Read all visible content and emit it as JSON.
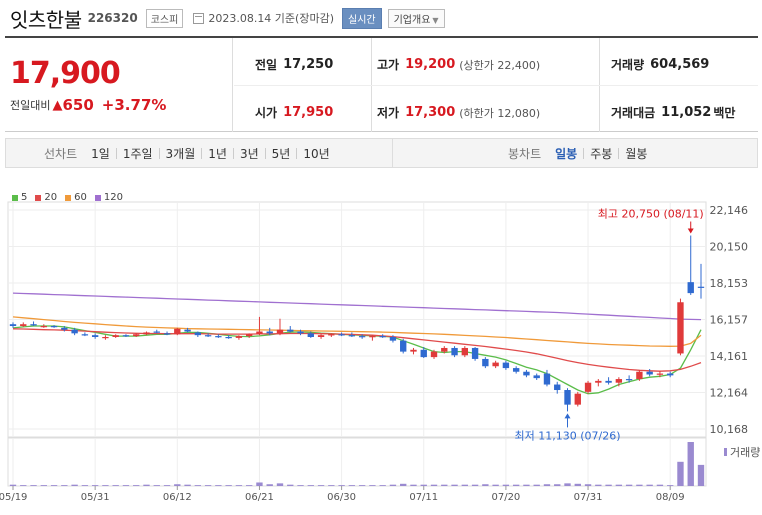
{
  "header": {
    "name": "잇츠한불",
    "code": "226320",
    "market": "코스피",
    "date": "2023.08.14 기준(장마감)",
    "realtime": "실시간",
    "info": "기업개요"
  },
  "summary": {
    "price": "17,900",
    "change_label": "전일대비",
    "change_value": "650",
    "change_pct": "+3.77%",
    "prev_label": "전일",
    "prev_value": "17,250",
    "open_label": "시가",
    "open_value": "17,950",
    "high_label": "고가",
    "high_value": "19,200",
    "high_limit": "(상한가 22,400)",
    "low_label": "저가",
    "low_value": "17,300",
    "low_limit": "(하한가 12,080)",
    "volume_label": "거래량",
    "volume_value": "604,569",
    "amount_label": "거래대금",
    "amount_value": "11,052",
    "amount_unit": "백만"
  },
  "period_bar": {
    "line_title": "선차트",
    "line_items": [
      "1일",
      "1주일",
      "3개월",
      "1년",
      "3년",
      "5년",
      "10년"
    ],
    "candle_title": "봉차트",
    "candle_items": [
      "일봉",
      "주봉",
      "월봉"
    ],
    "candle_selected": "일봉"
  },
  "colors": {
    "up": "#e03a3a",
    "down": "#2f6ad0",
    "ma5": "#5bbd4a",
    "ma20": "#e04b4b",
    "ma60": "#f09a3a",
    "ma120": "#a070d0",
    "volume": "#9a8ad0"
  },
  "chart_data": {
    "type": "candlestick",
    "title": "",
    "xlabel": "",
    "ylabel": "",
    "ylim": [
      10168,
      22146
    ],
    "y_ticks": [
      "22,146",
      "20,150",
      "18,153",
      "16,157",
      "14,161",
      "12,164",
      "10,168"
    ],
    "y_tick_values": [
      22146,
      20150,
      18153,
      16157,
      14161,
      12164,
      10168
    ],
    "x_ticks": [
      "05/19",
      "05/31",
      "06/12",
      "06/21",
      "06/30",
      "07/11",
      "07/20",
      "07/31",
      "08/09"
    ],
    "x_tick_index": [
      0,
      8,
      16,
      24,
      32,
      40,
      48,
      56,
      64
    ],
    "legend": [
      "5",
      "20",
      "60",
      "120"
    ],
    "volume_label": "거래량",
    "annotations": {
      "max": "최고 20,750 (08/11)",
      "min": "최저 11,130 (07/26)"
    },
    "candles": [
      {
        "o": 15900,
        "h": 16000,
        "l": 15700,
        "c": 15800
      },
      {
        "o": 15800,
        "h": 16000,
        "l": 15750,
        "c": 15900
      },
      {
        "o": 15900,
        "h": 16050,
        "l": 15800,
        "c": 15850
      },
      {
        "o": 15800,
        "h": 15900,
        "l": 15700,
        "c": 15800
      },
      {
        "o": 15800,
        "h": 15850,
        "l": 15700,
        "c": 15750
      },
      {
        "o": 15700,
        "h": 15800,
        "l": 15500,
        "c": 15600
      },
      {
        "o": 15600,
        "h": 15700,
        "l": 15300,
        "c": 15400
      },
      {
        "o": 15350,
        "h": 15450,
        "l": 15250,
        "c": 15300
      },
      {
        "o": 15300,
        "h": 15400,
        "l": 15100,
        "c": 15200
      },
      {
        "o": 15150,
        "h": 15300,
        "l": 15050,
        "c": 15200
      },
      {
        "o": 15200,
        "h": 15350,
        "l": 15150,
        "c": 15300
      },
      {
        "o": 15300,
        "h": 15350,
        "l": 15200,
        "c": 15250
      },
      {
        "o": 15250,
        "h": 15400,
        "l": 15200,
        "c": 15350
      },
      {
        "o": 15350,
        "h": 15500,
        "l": 15300,
        "c": 15450
      },
      {
        "o": 15500,
        "h": 15600,
        "l": 15400,
        "c": 15450
      },
      {
        "o": 15400,
        "h": 15500,
        "l": 15300,
        "c": 15350
      },
      {
        "o": 15350,
        "h": 15700,
        "l": 15300,
        "c": 15650
      },
      {
        "o": 15600,
        "h": 15700,
        "l": 15450,
        "c": 15500
      },
      {
        "o": 15450,
        "h": 15500,
        "l": 15200,
        "c": 15300
      },
      {
        "o": 15300,
        "h": 15400,
        "l": 15200,
        "c": 15250
      },
      {
        "o": 15250,
        "h": 15350,
        "l": 15150,
        "c": 15200
      },
      {
        "o": 15200,
        "h": 15300,
        "l": 15100,
        "c": 15150
      },
      {
        "o": 15150,
        "h": 15300,
        "l": 15050,
        "c": 15250
      },
      {
        "o": 15250,
        "h": 15400,
        "l": 15150,
        "c": 15350
      },
      {
        "o": 15350,
        "h": 16300,
        "l": 15300,
        "c": 15500
      },
      {
        "o": 15500,
        "h": 15700,
        "l": 15300,
        "c": 15400
      },
      {
        "o": 15400,
        "h": 16200,
        "l": 15300,
        "c": 15600
      },
      {
        "o": 15600,
        "h": 15800,
        "l": 15450,
        "c": 15500
      },
      {
        "o": 15500,
        "h": 15600,
        "l": 15300,
        "c": 15400
      },
      {
        "o": 15400,
        "h": 15500,
        "l": 15150,
        "c": 15200
      },
      {
        "o": 15200,
        "h": 15350,
        "l": 15100,
        "c": 15300
      },
      {
        "o": 15300,
        "h": 15400,
        "l": 15200,
        "c": 15350
      },
      {
        "o": 15350,
        "h": 15450,
        "l": 15250,
        "c": 15300
      },
      {
        "o": 15300,
        "h": 15450,
        "l": 15200,
        "c": 15250
      },
      {
        "o": 15250,
        "h": 15350,
        "l": 15100,
        "c": 15200
      },
      {
        "o": 15200,
        "h": 15300,
        "l": 15000,
        "c": 15250
      },
      {
        "o": 15250,
        "h": 15350,
        "l": 15150,
        "c": 15200
      },
      {
        "o": 15200,
        "h": 15300,
        "l": 14900,
        "c": 15000
      },
      {
        "o": 15000,
        "h": 15100,
        "l": 14300,
        "c": 14400
      },
      {
        "o": 14400,
        "h": 14600,
        "l": 14250,
        "c": 14500
      },
      {
        "o": 14500,
        "h": 14650,
        "l": 14050,
        "c": 14100
      },
      {
        "o": 14100,
        "h": 14500,
        "l": 14000,
        "c": 14400
      },
      {
        "o": 14400,
        "h": 14700,
        "l": 14300,
        "c": 14600
      },
      {
        "o": 14600,
        "h": 14700,
        "l": 14100,
        "c": 14200
      },
      {
        "o": 14200,
        "h": 14700,
        "l": 14100,
        "c": 14600
      },
      {
        "o": 14600,
        "h": 14650,
        "l": 13900,
        "c": 14000
      },
      {
        "o": 14000,
        "h": 14100,
        "l": 13500,
        "c": 13600
      },
      {
        "o": 13600,
        "h": 13900,
        "l": 13500,
        "c": 13800
      },
      {
        "o": 13800,
        "h": 13900,
        "l": 13400,
        "c": 13500
      },
      {
        "o": 13500,
        "h": 13600,
        "l": 13200,
        "c": 13300
      },
      {
        "o": 13300,
        "h": 13400,
        "l": 13000,
        "c": 13100
      },
      {
        "o": 13100,
        "h": 13200,
        "l": 12850,
        "c": 12950
      },
      {
        "o": 13200,
        "h": 13400,
        "l": 12500,
        "c": 12600
      },
      {
        "o": 12600,
        "h": 12750,
        "l": 12100,
        "c": 12300
      },
      {
        "o": 12300,
        "h": 12400,
        "l": 11130,
        "c": 11500
      },
      {
        "o": 11500,
        "h": 12200,
        "l": 11400,
        "c": 12100
      },
      {
        "o": 12200,
        "h": 12800,
        "l": 12100,
        "c": 12700
      },
      {
        "o": 12700,
        "h": 12900,
        "l": 12500,
        "c": 12800
      },
      {
        "o": 12800,
        "h": 13000,
        "l": 12600,
        "c": 12700
      },
      {
        "o": 12700,
        "h": 13000,
        "l": 12500,
        "c": 12900
      },
      {
        "o": 12900,
        "h": 13100,
        "l": 12700,
        "c": 12850
      },
      {
        "o": 12900,
        "h": 13400,
        "l": 12800,
        "c": 13300
      },
      {
        "o": 13300,
        "h": 13450,
        "l": 13050,
        "c": 13150
      },
      {
        "o": 13150,
        "h": 13350,
        "l": 13000,
        "c": 13200
      },
      {
        "o": 13200,
        "h": 13300,
        "l": 13000,
        "c": 13100
      },
      {
        "o": 14300,
        "h": 17300,
        "l": 14200,
        "c": 17100
      },
      {
        "o": 18200,
        "h": 20750,
        "l": 17500,
        "c": 17600
      },
      {
        "o": 17950,
        "h": 19200,
        "l": 17300,
        "c": 17900
      }
    ],
    "ma": [
      {
        "name": "5",
        "values": [
          15700,
          15750,
          15800,
          15800,
          15800,
          15750,
          15650,
          15550,
          15450,
          15350,
          15250,
          15250,
          15250,
          15300,
          15350,
          15350,
          15400,
          15450,
          15450,
          15400,
          15350,
          15280,
          15230,
          15220,
          15260,
          15320,
          15400,
          15460,
          15480,
          15450,
          15410,
          15380,
          15350,
          15320,
          15290,
          15260,
          15240,
          15200,
          15000,
          14800,
          14600,
          14400,
          14350,
          14400,
          14400,
          14300,
          14200,
          14100,
          13950,
          13750,
          13550,
          13400,
          13200,
          12900,
          12600,
          12300,
          12100,
          12150,
          12350,
          12600,
          12750,
          12900,
          13000,
          13050,
          13150,
          13500,
          14500,
          15600
        ]
      },
      {
        "name": "20",
        "values": [
          15650,
          15640,
          15620,
          15600,
          15590,
          15570,
          15550,
          15520,
          15490,
          15460,
          15440,
          15420,
          15400,
          15390,
          15390,
          15380,
          15380,
          15380,
          15380,
          15370,
          15360,
          15360,
          15360,
          15360,
          15370,
          15370,
          15380,
          15390,
          15390,
          15390,
          15380,
          15370,
          15360,
          15340,
          15320,
          15300,
          15260,
          15220,
          15160,
          15100,
          15040,
          14980,
          14920,
          14860,
          14800,
          14740,
          14680,
          14610,
          14540,
          14460,
          14380,
          14280,
          14160,
          14040,
          13910,
          13800,
          13700,
          13620,
          13550,
          13480,
          13420,
          13380,
          13350,
          13330,
          13350,
          13430,
          13600,
          13800
        ]
      },
      {
        "name": "60",
        "values": [
          16300,
          16250,
          16200,
          16150,
          16100,
          16050,
          16000,
          15960,
          15920,
          15880,
          15840,
          15800,
          15770,
          15740,
          15720,
          15700,
          15680,
          15660,
          15650,
          15640,
          15630,
          15620,
          15610,
          15600,
          15590,
          15580,
          15570,
          15560,
          15550,
          15540,
          15530,
          15520,
          15510,
          15500,
          15490,
          15480,
          15470,
          15450,
          15430,
          15410,
          15390,
          15370,
          15350,
          15320,
          15290,
          15260,
          15230,
          15200,
          15170,
          15130,
          15090,
          15050,
          15010,
          14970,
          14930,
          14890,
          14850,
          14820,
          14790,
          14770,
          14750,
          14730,
          14710,
          14700,
          14690,
          14700,
          14850,
          15300
        ]
      },
      {
        "name": "120",
        "values": [
          17600,
          17580,
          17560,
          17540,
          17520,
          17500,
          17480,
          17460,
          17440,
          17420,
          17400,
          17380,
          17360,
          17340,
          17320,
          17300,
          17280,
          17260,
          17240,
          17220,
          17200,
          17180,
          17160,
          17140,
          17120,
          17100,
          17080,
          17060,
          17040,
          17020,
          17000,
          16980,
          16960,
          16940,
          16920,
          16900,
          16880,
          16860,
          16840,
          16820,
          16800,
          16780,
          16760,
          16740,
          16720,
          16700,
          16680,
          16660,
          16640,
          16620,
          16600,
          16580,
          16560,
          16540,
          16510,
          16480,
          16450,
          16420,
          16390,
          16360,
          16330,
          16300,
          16270,
          16240,
          16210,
          16180,
          16160,
          16150
        ]
      }
    ],
    "volume": [
      3,
      2,
      2,
      2,
      2,
      2,
      3,
      2,
      2,
      2,
      2,
      2,
      2,
      3,
      2,
      2,
      4,
      3,
      2,
      2,
      2,
      2,
      2,
      2,
      8,
      4,
      6,
      3,
      2,
      2,
      2,
      2,
      2,
      2,
      2,
      2,
      2,
      3,
      5,
      3,
      3,
      3,
      3,
      3,
      3,
      3,
      4,
      3,
      3,
      3,
      3,
      3,
      4,
      4,
      6,
      5,
      4,
      3,
      3,
      3,
      3,
      3,
      3,
      3,
      2,
      55,
      100,
      48
    ]
  }
}
